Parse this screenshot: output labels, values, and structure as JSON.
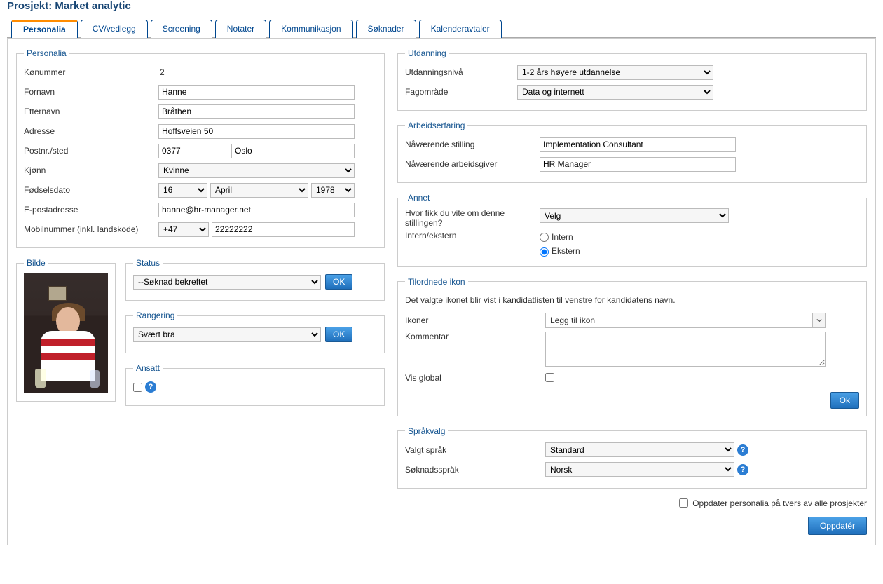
{
  "page_title": "Prosjekt: Market analytic",
  "tabs": [
    "Personalia",
    "CV/vedlegg",
    "Screening",
    "Notater",
    "Kommunikasjon",
    "Søknader",
    "Kalenderavtaler"
  ],
  "personalia": {
    "legend": "Personalia",
    "konummer_label": "Kønummer",
    "konummer_value": "2",
    "fornavn_label": "Fornavn",
    "fornavn_value": "Hanne",
    "etternavn_label": "Etternavn",
    "etternavn_value": "Bråthen",
    "adresse_label": "Adresse",
    "adresse_value": "Hoffsveien 50",
    "postnr_label": "Postnr./sted",
    "postnr_value": "0377",
    "sted_value": "Oslo",
    "kjonn_label": "Kjønn",
    "kjonn_value": "Kvinne",
    "fodselsdato_label": "Fødselsdato",
    "dag_value": "16",
    "maned_value": "April",
    "aar_value": "1978",
    "epost_label": "E-postadresse",
    "epost_value": "hanne@hr-manager.net",
    "mobil_label": "Mobilnummer (inkl. landskode)",
    "mobil_country": "+47",
    "mobil_value": "22222222"
  },
  "bilde": {
    "legend": "Bilde"
  },
  "status": {
    "legend": "Status",
    "value": "--Søknad bekreftet",
    "ok": "OK"
  },
  "rangering": {
    "legend": "Rangering",
    "value": "Svært bra",
    "ok": "OK"
  },
  "ansatt": {
    "legend": "Ansatt"
  },
  "utdanning": {
    "legend": "Utdanning",
    "nivaa_label": "Utdanningsnivå",
    "nivaa_value": "1-2 års høyere utdannelse",
    "fag_label": "Fagområde",
    "fag_value": "Data og internett"
  },
  "arbeidserfaring": {
    "legend": "Arbeidserfaring",
    "stilling_label": "Nåværende stilling",
    "stilling_value": "Implementation Consultant",
    "arbeidsgiver_label": "Nåværende arbeidsgiver",
    "arbeidsgiver_value": "HR Manager"
  },
  "annet": {
    "legend": "Annet",
    "hvor_label": "Hvor fikk du vite om denne stillingen?",
    "hvor_value": "Velg",
    "internekstern_label": "Intern/ekstern",
    "intern": "Intern",
    "ekstern": "Ekstern"
  },
  "tilordnede": {
    "legend": "Tilordnede ikon",
    "info": "Det valgte ikonet blir vist i kandidatlisten til venstre for kandidatens navn.",
    "ikoner_label": "Ikoner",
    "ikoner_value": "Legg til ikon",
    "kommentar_label": "Kommentar",
    "visglobal_label": "Vis global",
    "ok": "Ok"
  },
  "sprak": {
    "legend": "Språkvalg",
    "valgt_label": "Valgt språk",
    "valgt_value": "Standard",
    "soknad_label": "Søknadsspråk",
    "soknad_value": "Norsk"
  },
  "footer": {
    "update_cross": "Oppdater personalia på tvers av alle prosjekter",
    "oppdater_btn": "Oppdatér"
  }
}
